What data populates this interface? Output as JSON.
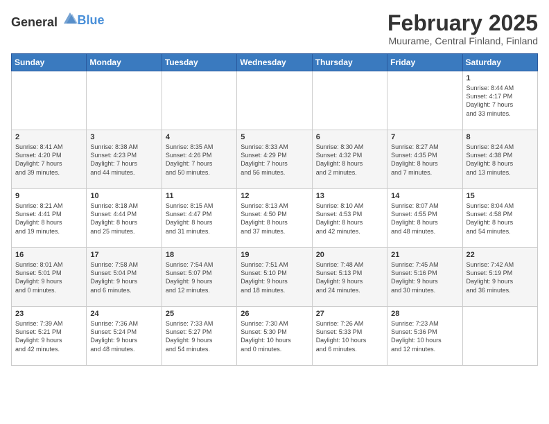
{
  "header": {
    "logo_general": "General",
    "logo_blue": "Blue",
    "title": "February 2025",
    "subtitle": "Muurame, Central Finland, Finland"
  },
  "days_of_week": [
    "Sunday",
    "Monday",
    "Tuesday",
    "Wednesday",
    "Thursday",
    "Friday",
    "Saturday"
  ],
  "weeks": [
    [
      {
        "day": "",
        "info": ""
      },
      {
        "day": "",
        "info": ""
      },
      {
        "day": "",
        "info": ""
      },
      {
        "day": "",
        "info": ""
      },
      {
        "day": "",
        "info": ""
      },
      {
        "day": "",
        "info": ""
      },
      {
        "day": "1",
        "info": "Sunrise: 8:44 AM\nSunset: 4:17 PM\nDaylight: 7 hours\nand 33 minutes."
      }
    ],
    [
      {
        "day": "2",
        "info": "Sunrise: 8:41 AM\nSunset: 4:20 PM\nDaylight: 7 hours\nand 39 minutes."
      },
      {
        "day": "3",
        "info": "Sunrise: 8:38 AM\nSunset: 4:23 PM\nDaylight: 7 hours\nand 44 minutes."
      },
      {
        "day": "4",
        "info": "Sunrise: 8:35 AM\nSunset: 4:26 PM\nDaylight: 7 hours\nand 50 minutes."
      },
      {
        "day": "5",
        "info": "Sunrise: 8:33 AM\nSunset: 4:29 PM\nDaylight: 7 hours\nand 56 minutes."
      },
      {
        "day": "6",
        "info": "Sunrise: 8:30 AM\nSunset: 4:32 PM\nDaylight: 8 hours\nand 2 minutes."
      },
      {
        "day": "7",
        "info": "Sunrise: 8:27 AM\nSunset: 4:35 PM\nDaylight: 8 hours\nand 7 minutes."
      },
      {
        "day": "8",
        "info": "Sunrise: 8:24 AM\nSunset: 4:38 PM\nDaylight: 8 hours\nand 13 minutes."
      }
    ],
    [
      {
        "day": "9",
        "info": "Sunrise: 8:21 AM\nSunset: 4:41 PM\nDaylight: 8 hours\nand 19 minutes."
      },
      {
        "day": "10",
        "info": "Sunrise: 8:18 AM\nSunset: 4:44 PM\nDaylight: 8 hours\nand 25 minutes."
      },
      {
        "day": "11",
        "info": "Sunrise: 8:15 AM\nSunset: 4:47 PM\nDaylight: 8 hours\nand 31 minutes."
      },
      {
        "day": "12",
        "info": "Sunrise: 8:13 AM\nSunset: 4:50 PM\nDaylight: 8 hours\nand 37 minutes."
      },
      {
        "day": "13",
        "info": "Sunrise: 8:10 AM\nSunset: 4:53 PM\nDaylight: 8 hours\nand 42 minutes."
      },
      {
        "day": "14",
        "info": "Sunrise: 8:07 AM\nSunset: 4:55 PM\nDaylight: 8 hours\nand 48 minutes."
      },
      {
        "day": "15",
        "info": "Sunrise: 8:04 AM\nSunset: 4:58 PM\nDaylight: 8 hours\nand 54 minutes."
      }
    ],
    [
      {
        "day": "16",
        "info": "Sunrise: 8:01 AM\nSunset: 5:01 PM\nDaylight: 9 hours\nand 0 minutes."
      },
      {
        "day": "17",
        "info": "Sunrise: 7:58 AM\nSunset: 5:04 PM\nDaylight: 9 hours\nand 6 minutes."
      },
      {
        "day": "18",
        "info": "Sunrise: 7:54 AM\nSunset: 5:07 PM\nDaylight: 9 hours\nand 12 minutes."
      },
      {
        "day": "19",
        "info": "Sunrise: 7:51 AM\nSunset: 5:10 PM\nDaylight: 9 hours\nand 18 minutes."
      },
      {
        "day": "20",
        "info": "Sunrise: 7:48 AM\nSunset: 5:13 PM\nDaylight: 9 hours\nand 24 minutes."
      },
      {
        "day": "21",
        "info": "Sunrise: 7:45 AM\nSunset: 5:16 PM\nDaylight: 9 hours\nand 30 minutes."
      },
      {
        "day": "22",
        "info": "Sunrise: 7:42 AM\nSunset: 5:19 PM\nDaylight: 9 hours\nand 36 minutes."
      }
    ],
    [
      {
        "day": "23",
        "info": "Sunrise: 7:39 AM\nSunset: 5:21 PM\nDaylight: 9 hours\nand 42 minutes."
      },
      {
        "day": "24",
        "info": "Sunrise: 7:36 AM\nSunset: 5:24 PM\nDaylight: 9 hours\nand 48 minutes."
      },
      {
        "day": "25",
        "info": "Sunrise: 7:33 AM\nSunset: 5:27 PM\nDaylight: 9 hours\nand 54 minutes."
      },
      {
        "day": "26",
        "info": "Sunrise: 7:30 AM\nSunset: 5:30 PM\nDaylight: 10 hours\nand 0 minutes."
      },
      {
        "day": "27",
        "info": "Sunrise: 7:26 AM\nSunset: 5:33 PM\nDaylight: 10 hours\nand 6 minutes."
      },
      {
        "day": "28",
        "info": "Sunrise: 7:23 AM\nSunset: 5:36 PM\nDaylight: 10 hours\nand 12 minutes."
      },
      {
        "day": "",
        "info": ""
      }
    ]
  ]
}
